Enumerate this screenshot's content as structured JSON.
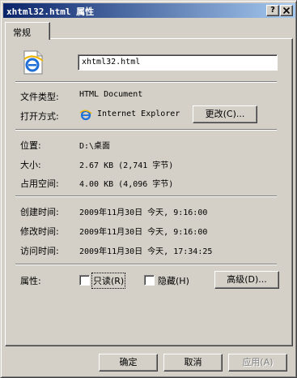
{
  "window": {
    "title": "xhtml32.html 属性",
    "help_button": "?",
    "close_button": "X"
  },
  "tabs": [
    {
      "label": "常规",
      "selected": true
    }
  ],
  "general": {
    "file_icon": "ie-html-file-icon",
    "file_name": "xhtml32.html",
    "file_type_label": "文件类型:",
    "file_type_value": "HTML Document",
    "opens_with_label": "打开方式:",
    "opens_with_icon": "ie-app-icon",
    "opens_with_value": "Internet Explorer",
    "change_button": "更改(C)...",
    "location_label": "位置:",
    "location_value": "D:\\桌面",
    "size_label": "大小:",
    "size_value": "2.67 KB (2,741 字节)",
    "size_on_disk_label": "占用空间:",
    "size_on_disk_value": "4.00 KB (4,096 字节)",
    "created_label": "创建时间:",
    "created_value": "2009年11月30日 今天, 9:16:00",
    "modified_label": "修改时间:",
    "modified_value": "2009年11月30日 今天, 9:16:00",
    "accessed_label": "访问时间:",
    "accessed_value": "2009年11月30日 今天, 17:34:25",
    "attributes_label": "属性:",
    "readonly_label": "只读(R)",
    "readonly_checked": false,
    "hidden_label": "隐藏(H)",
    "hidden_checked": false,
    "advanced_button": "高级(D)..."
  },
  "footer": {
    "ok_button": "确定",
    "cancel_button": "取消",
    "apply_button": "应用(A)"
  },
  "colors": {
    "titlebar_start": "#0a246a",
    "titlebar_end": "#a6caf0",
    "face": "#d4d0c8"
  }
}
